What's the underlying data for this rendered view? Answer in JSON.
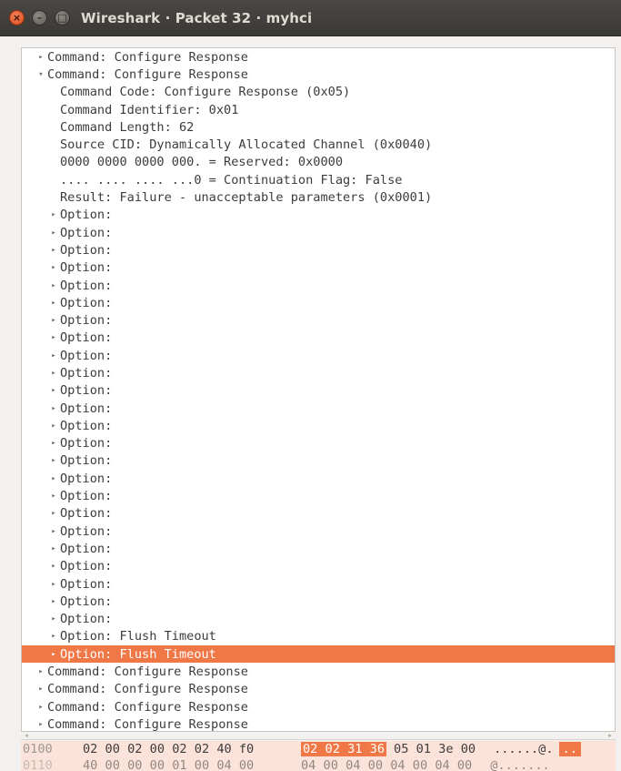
{
  "window": {
    "title": "Wireshark · Packet 32 · myhci",
    "close_glyph": "×",
    "min_glyph": "–",
    "max_glyph": "□"
  },
  "colors": {
    "selection": "#f07746",
    "hex_highlight_bg": "#fbe3d9",
    "titlebar": "#3c3b37"
  },
  "tree": {
    "collapsed_arrow": "▸",
    "expanded_arrow": "▾",
    "rows": [
      {
        "text": "Command: Configure Response",
        "indent": 2,
        "arrow": "collapsed"
      },
      {
        "text": "Command: Configure Response",
        "indent": 2,
        "arrow": "expanded"
      },
      {
        "text": "Command Code: Configure Response (0x05)",
        "indent": 3,
        "arrow": "none"
      },
      {
        "text": "Command Identifier: 0x01",
        "indent": 3,
        "arrow": "none"
      },
      {
        "text": "Command Length: 62",
        "indent": 3,
        "arrow": "none"
      },
      {
        "text": "Source CID: Dynamically Allocated Channel (0x0040)",
        "indent": 3,
        "arrow": "none"
      },
      {
        "text": "0000 0000 0000 000. = Reserved: 0x0000",
        "indent": 3,
        "arrow": "none"
      },
      {
        "text": ".... .... .... ...0 = Continuation Flag: False",
        "indent": 3,
        "arrow": "none"
      },
      {
        "text": "Result: Failure - unacceptable parameters (0x0001)",
        "indent": 3,
        "arrow": "none"
      },
      {
        "text": "Option:",
        "indent": 3,
        "arrow": "collapsed"
      },
      {
        "text": "Option:",
        "indent": 3,
        "arrow": "collapsed"
      },
      {
        "text": "Option:",
        "indent": 3,
        "arrow": "collapsed"
      },
      {
        "text": "Option:",
        "indent": 3,
        "arrow": "collapsed"
      },
      {
        "text": "Option:",
        "indent": 3,
        "arrow": "collapsed"
      },
      {
        "text": "Option:",
        "indent": 3,
        "arrow": "collapsed"
      },
      {
        "text": "Option:",
        "indent": 3,
        "arrow": "collapsed"
      },
      {
        "text": "Option:",
        "indent": 3,
        "arrow": "collapsed"
      },
      {
        "text": "Option:",
        "indent": 3,
        "arrow": "collapsed"
      },
      {
        "text": "Option:",
        "indent": 3,
        "arrow": "collapsed"
      },
      {
        "text": "Option:",
        "indent": 3,
        "arrow": "collapsed"
      },
      {
        "text": "Option:",
        "indent": 3,
        "arrow": "collapsed"
      },
      {
        "text": "Option:",
        "indent": 3,
        "arrow": "collapsed"
      },
      {
        "text": "Option:",
        "indent": 3,
        "arrow": "collapsed"
      },
      {
        "text": "Option:",
        "indent": 3,
        "arrow": "collapsed"
      },
      {
        "text": "Option:",
        "indent": 3,
        "arrow": "collapsed"
      },
      {
        "text": "Option:",
        "indent": 3,
        "arrow": "collapsed"
      },
      {
        "text": "Option:",
        "indent": 3,
        "arrow": "collapsed"
      },
      {
        "text": "Option:",
        "indent": 3,
        "arrow": "collapsed"
      },
      {
        "text": "Option:",
        "indent": 3,
        "arrow": "collapsed"
      },
      {
        "text": "Option:",
        "indent": 3,
        "arrow": "collapsed"
      },
      {
        "text": "Option:",
        "indent": 3,
        "arrow": "collapsed"
      },
      {
        "text": "Option:",
        "indent": 3,
        "arrow": "collapsed"
      },
      {
        "text": "Option:",
        "indent": 3,
        "arrow": "collapsed"
      },
      {
        "text": "Option: Flush Timeout",
        "indent": 3,
        "arrow": "collapsed"
      },
      {
        "text": "Option: Flush Timeout",
        "indent": 3,
        "arrow": "collapsed",
        "selected": true
      },
      {
        "text": "Command: Configure Response",
        "indent": 2,
        "arrow": "collapsed"
      },
      {
        "text": "Command: Configure Response",
        "indent": 2,
        "arrow": "collapsed"
      },
      {
        "text": "Command: Configure Response",
        "indent": 2,
        "arrow": "collapsed"
      },
      {
        "text": "Command: Configure Response",
        "indent": 2,
        "arrow": "collapsed"
      }
    ]
  },
  "hex": {
    "rows": [
      {
        "offset": "0100",
        "bytes": "02 00 02 00 02 02 40 f0",
        "bytes_highlight": "02 02 31 36",
        "bytes_rest": "05 01 3e 00",
        "ascii": "......@.",
        "ascii_highlight": ".."
      },
      {
        "offset": "0110",
        "bytes": "40 00 00 00 01 00 04 00",
        "bytes_highlight": "",
        "bytes_rest": "04 00 04 00 04 00 04 00",
        "ascii": "@.......",
        "ascii_highlight": ""
      }
    ]
  }
}
